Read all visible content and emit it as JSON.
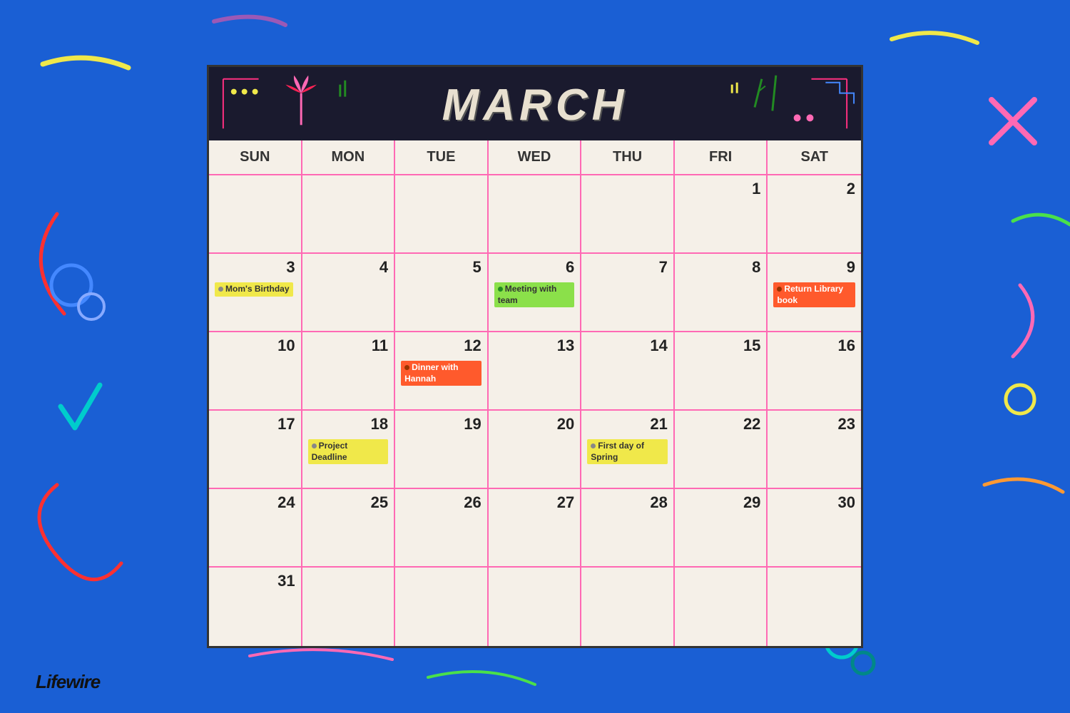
{
  "page": {
    "background_color": "#1a5fd4",
    "brand": "Lifewire"
  },
  "calendar": {
    "month": "MARCH",
    "day_names": [
      "SUN",
      "MON",
      "TUE",
      "WED",
      "THU",
      "FRI",
      "SAT"
    ],
    "cells": [
      {
        "date": null,
        "events": []
      },
      {
        "date": null,
        "events": []
      },
      {
        "date": null,
        "events": []
      },
      {
        "date": null,
        "events": []
      },
      {
        "date": null,
        "events": []
      },
      {
        "date": "1",
        "events": []
      },
      {
        "date": "2",
        "events": []
      },
      {
        "date": "3",
        "events": [
          {
            "label": "Mom's Birthday",
            "color": "yellow"
          }
        ]
      },
      {
        "date": "4",
        "events": []
      },
      {
        "date": "5",
        "events": []
      },
      {
        "date": "6",
        "events": [
          {
            "label": "Meeting with team",
            "color": "green"
          }
        ]
      },
      {
        "date": "7",
        "events": []
      },
      {
        "date": "8",
        "events": []
      },
      {
        "date": "9",
        "events": [
          {
            "label": "Return Library book",
            "color": "orange"
          }
        ]
      },
      {
        "date": "10",
        "events": []
      },
      {
        "date": "11",
        "events": []
      },
      {
        "date": "12",
        "events": [
          {
            "label": "Dinner with Hannah",
            "color": "orange"
          }
        ]
      },
      {
        "date": "13",
        "events": []
      },
      {
        "date": "14",
        "events": []
      },
      {
        "date": "15",
        "events": []
      },
      {
        "date": "16",
        "events": []
      },
      {
        "date": "17",
        "events": []
      },
      {
        "date": "18",
        "events": [
          {
            "label": "Project Deadline",
            "color": "yellow"
          }
        ]
      },
      {
        "date": "19",
        "events": []
      },
      {
        "date": "20",
        "events": []
      },
      {
        "date": "21",
        "events": [
          {
            "label": "First day of Spring",
            "color": "yellow"
          }
        ]
      },
      {
        "date": "22",
        "events": []
      },
      {
        "date": "23",
        "events": []
      },
      {
        "date": "24",
        "events": []
      },
      {
        "date": "25",
        "events": []
      },
      {
        "date": "26",
        "events": []
      },
      {
        "date": "27",
        "events": []
      },
      {
        "date": "28",
        "events": []
      },
      {
        "date": "29",
        "events": []
      },
      {
        "date": "30",
        "events": []
      },
      {
        "date": "31",
        "events": []
      },
      {
        "date": null,
        "events": []
      },
      {
        "date": null,
        "events": []
      },
      {
        "date": null,
        "events": []
      },
      {
        "date": null,
        "events": []
      },
      {
        "date": null,
        "events": []
      },
      {
        "date": null,
        "events": []
      }
    ]
  }
}
